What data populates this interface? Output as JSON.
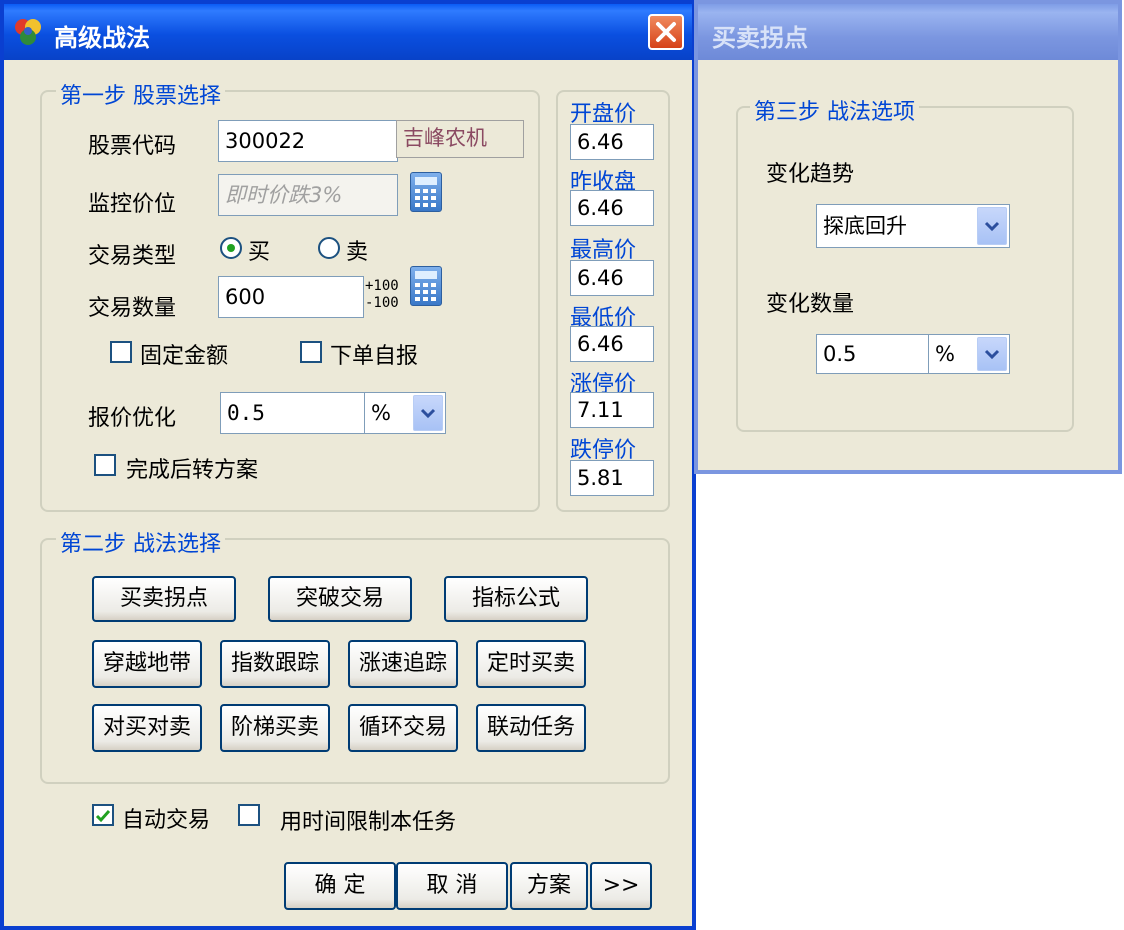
{
  "main_window": {
    "title": "高级战法",
    "step1": {
      "title": "第一步  股票选择",
      "stock_code_label": "股票代码",
      "stock_code_value": "300022",
      "stock_name": "吉峰农机",
      "monitor_price_label": "监控价位",
      "monitor_price_placeholder": "即时价跌3%",
      "trade_type_label": "交易类型",
      "buy_label": "买",
      "sell_label": "卖",
      "trade_qty_label": "交易数量",
      "trade_qty_value": "600",
      "step_plus": "+100",
      "step_minus": "-100",
      "fixed_amount_label": "固定金额",
      "self_report_label": "下单自报",
      "price_opt_label": "报价优化",
      "price_opt_value": "0.5",
      "price_opt_unit": "%",
      "switch_plan_label": "完成后转方案"
    },
    "prices": {
      "open_label": "开盘价",
      "open_value": "6.46",
      "prev_close_label": "昨收盘",
      "prev_close_value": "6.46",
      "high_label": "最高价",
      "high_value": "6.46",
      "low_label": "最低价",
      "low_value": "6.46",
      "limit_up_label": "涨停价",
      "limit_up_value": "7.11",
      "limit_down_label": "跌停价",
      "limit_down_value": "5.81"
    },
    "step2": {
      "title": "第二步  战法选择",
      "row1": [
        "买卖拐点",
        "突破交易",
        "指标公式"
      ],
      "row2": [
        "穿越地带",
        "指数跟踪",
        "涨速追踪",
        "定时买卖"
      ],
      "row3": [
        "对买对卖",
        "阶梯买卖",
        "循环交易",
        "联动任务"
      ]
    },
    "auto_trade_label": "自动交易",
    "time_limit_label": "用时间限制本任务",
    "ok_label": "确 定",
    "cancel_label": "取 消",
    "plan_label": "方案",
    "more_label": ">>"
  },
  "side_window": {
    "title": "买卖拐点",
    "step3_title": "第三步  战法选项",
    "trend_label": "变化趋势",
    "trend_value": "探底回升",
    "qty_label": "变化数量",
    "qty_value": "0.5",
    "qty_unit": "%"
  },
  "colors": {
    "titlebar_active": "#0a4fe0",
    "titlebar_inactive": "#7b96e0",
    "window_bg": "#ece9d8",
    "group_title": "#0046d5",
    "close_button": "#e0541f"
  }
}
